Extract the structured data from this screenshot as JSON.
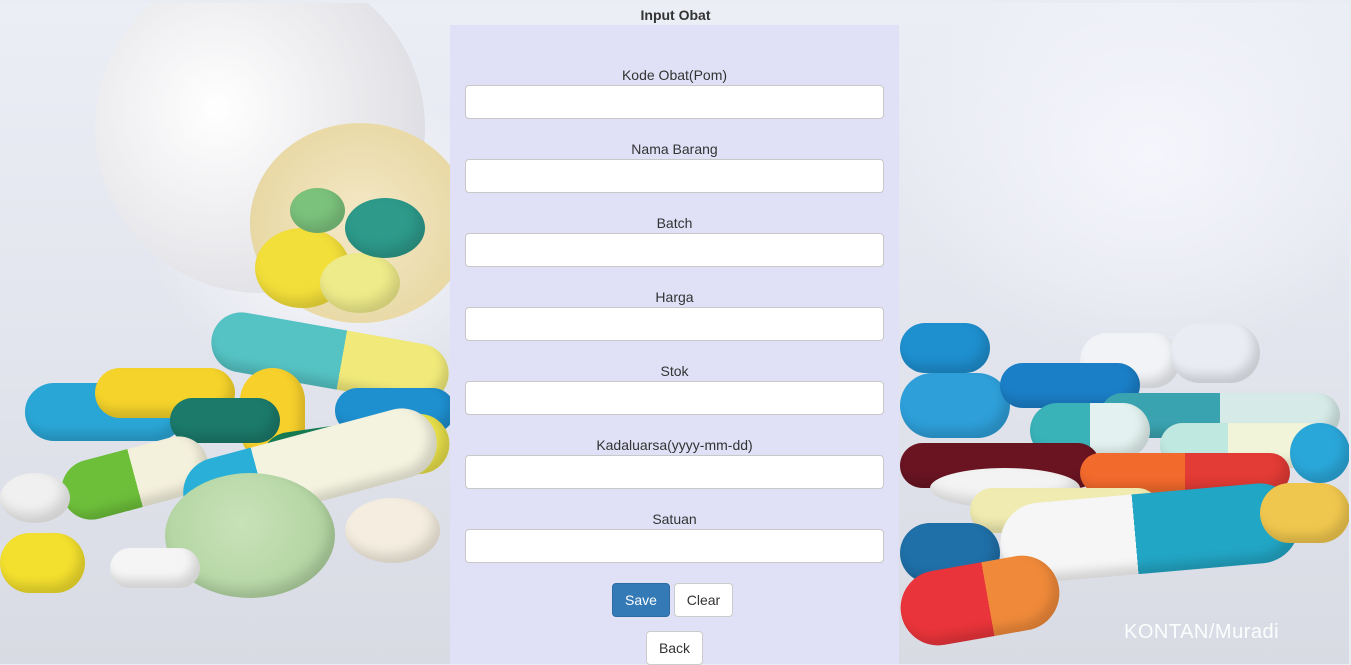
{
  "page": {
    "title": "Input Obat"
  },
  "form": {
    "fields": [
      {
        "label": "Kode Obat(Pom)",
        "value": ""
      },
      {
        "label": "Nama Barang",
        "value": ""
      },
      {
        "label": "Batch",
        "value": ""
      },
      {
        "label": "Harga",
        "value": ""
      },
      {
        "label": "Stok",
        "value": ""
      },
      {
        "label": "Kadaluarsa(yyyy-mm-dd)",
        "value": ""
      },
      {
        "label": "Satuan",
        "value": ""
      }
    ],
    "save_label": "Save",
    "clear_label": "Clear",
    "back_label": "Back"
  },
  "background": {
    "watermark": "KONTAN/Muradi",
    "colors": {
      "panel": "#e0e1f7",
      "primary": "#337ab7"
    }
  }
}
